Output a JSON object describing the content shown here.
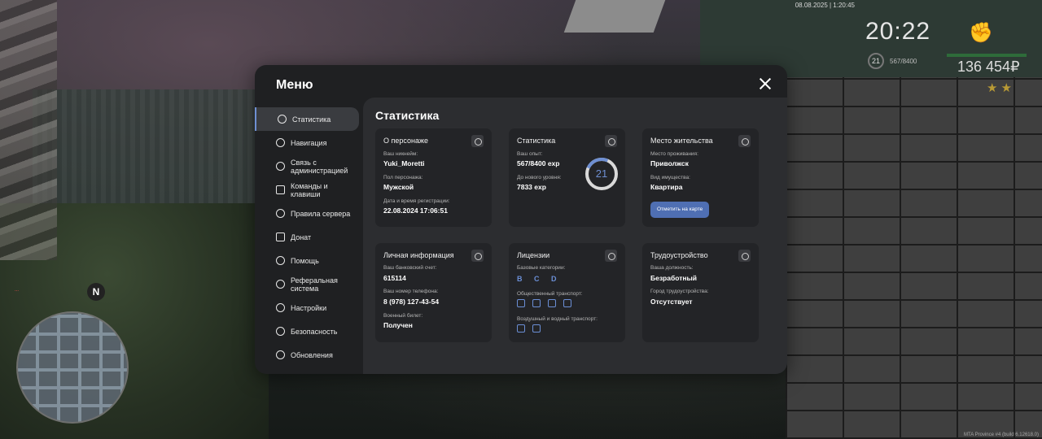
{
  "hud": {
    "date": "08.08.2025 | 1:20:45",
    "time": "20:22",
    "level": "21",
    "exp": "567/8400",
    "money": "136 454₽",
    "stars": "★★",
    "chat": "...",
    "build": "MTA Province #4 (build 6.12618.0)",
    "north": "N"
  },
  "menu": {
    "title": "Меню",
    "content_title": "Статистика"
  },
  "sidebar": {
    "items": [
      {
        "label": "Статистика"
      },
      {
        "label": "Навигация"
      },
      {
        "label": "Связь с администрацией"
      },
      {
        "label": "Команды и клавиши"
      },
      {
        "label": "Правила сервера"
      },
      {
        "label": "Донат"
      },
      {
        "label": "Помощь"
      },
      {
        "label": "Реферальная система"
      },
      {
        "label": "Настройки"
      },
      {
        "label": "Безопасность"
      },
      {
        "label": "Обновления"
      }
    ]
  },
  "cards": {
    "about": {
      "title": "О персонаже",
      "nick_label": "Ваш никнейм:",
      "nick": "Yuki_Moretti",
      "gender_label": "Пол персонажа:",
      "gender": "Мужской",
      "reg_label": "Дата и время регистрации:",
      "reg": "22.08.2024 17:06:51"
    },
    "stats": {
      "title": "Статистика",
      "exp_label": "Ваш опыт:",
      "exp": "567/8400 exp",
      "next_label": "До нового уровня:",
      "next": "7833 exp",
      "level": "21",
      "level_progress": 0.0675
    },
    "residence": {
      "title": "Место жительства",
      "place_label": "Место проживания:",
      "place": "Приволжск",
      "property_label": "Вид имущества:",
      "property": "Квартира",
      "map_button": "Отметить на карте"
    },
    "personal": {
      "title": "Личная информация",
      "bank_label": "Ваш банковский счет:",
      "bank": "615114",
      "phone_label": "Ваш номер телефона:",
      "phone": "8 (978) 127-43-54",
      "military_label": "Военный билет:",
      "military": "Получен"
    },
    "licenses": {
      "title": "Лицензии",
      "base_label": "Базовые категории:",
      "base": "B C D",
      "public_label": "Общественный транспорт:",
      "air_label": "Воздушный и водный транспорт:"
    },
    "employment": {
      "title": "Трудоустройство",
      "position_label": "Ваша должность:",
      "position": "Безработный",
      "city_label": "Город трудоустройства:",
      "city": "Отсутствует"
    }
  }
}
